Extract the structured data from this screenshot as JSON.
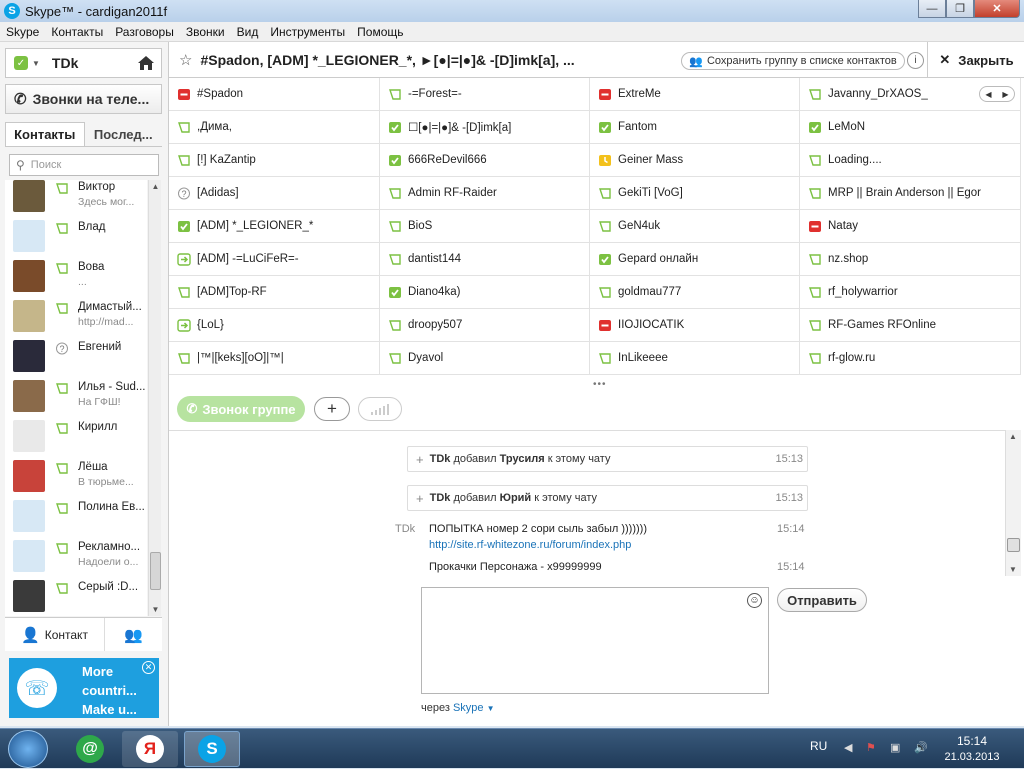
{
  "window": {
    "title": "Skype™ - cardigan2011f"
  },
  "menu": [
    "Skype",
    "Контакты",
    "Разговоры",
    "Звонки",
    "Вид",
    "Инструменты",
    "Помощь"
  ],
  "profile": {
    "name": "TDk",
    "status": "online"
  },
  "left": {
    "calls_label": "Звонки на теле...",
    "tabs": [
      "Контакты",
      "Послед..."
    ],
    "search_placeholder": "Поиск",
    "contacts": [
      {
        "name": "Виктор",
        "mood": "Здесь мог...",
        "status": "offline"
      },
      {
        "name": "Влад",
        "mood": "",
        "status": "offline"
      },
      {
        "name": "Вова",
        "mood": "...",
        "status": "offline"
      },
      {
        "name": "Димастый...",
        "mood": "http://mad...",
        "status": "offline"
      },
      {
        "name": "Евгений",
        "mood": "",
        "status": "unknown"
      },
      {
        "name": "Илья - Sud...",
        "mood": "На ГФШ!",
        "status": "offline"
      },
      {
        "name": "Кирилл",
        "mood": "",
        "status": "offline"
      },
      {
        "name": "Лёша",
        "mood": "В тюрьме...",
        "status": "offline"
      },
      {
        "name": "Полина Ев...",
        "mood": "",
        "status": "offline"
      },
      {
        "name": "Рекламно...",
        "mood": "Надоели о...",
        "status": "offline"
      },
      {
        "name": "Серый :D...",
        "mood": "",
        "status": "offline"
      }
    ],
    "add_contact_label": "Контакт",
    "promo": {
      "line1": "More",
      "line2": "countri...",
      "line3": "Make u..."
    }
  },
  "chat_header": {
    "name": "#Spadon, [ADM] *_LEGIONER_*, ►[●|=|●]& -[D]imk[a], ...",
    "save_group_label": "Сохранить группу в списке контактов",
    "close_label": "Закрыть"
  },
  "participants": [
    [
      "#Spadon",
      "-=Forest=-",
      "ExtreMe",
      "Javanny_DrXAOS_"
    ],
    [
      ",Дима,",
      "☐[●|=|●]& -[D]imk[a]",
      "Fantom",
      "LeMoN"
    ],
    [
      "[!] KaZantip",
      "666ReDevil666",
      "Geiner Mass",
      "Loading...."
    ],
    [
      "[Adidas]",
      "Admin RF-Raider",
      "GekiTi [VoG]",
      "MRP || Brain Anderson || Egor"
    ],
    [
      "[ADM] *_LEGIONER_*",
      "BioS",
      "GeN4uk",
      "Natay"
    ],
    [
      "[ADM] -=LuCiFeR=-",
      "dantist144",
      "Gepard онлайн",
      "nz.shop"
    ],
    [
      "[ADM]Top-RF",
      "Diano4ka)",
      "goldmau777",
      "rf_holywarrior"
    ],
    [
      "{LoL}",
      "droopy507",
      "IIOJIOCATIK",
      "RF-Games RFOnline"
    ],
    [
      "|™|[keks][oO]|™|",
      "Dyavol",
      "InLikeeee",
      "rf-glow.ru"
    ]
  ],
  "participant_status": [
    [
      "busy",
      "offline",
      "busy",
      "offline"
    ],
    [
      "offline",
      "online",
      "online",
      "online"
    ],
    [
      "offline",
      "online",
      "away",
      "offline"
    ],
    [
      "unknown",
      "offline",
      "offline",
      "offline"
    ],
    [
      "online",
      "offline",
      "offline",
      "busy"
    ],
    [
      "forward",
      "offline",
      "online",
      "offline"
    ],
    [
      "offline",
      "online",
      "offline",
      "offline"
    ],
    [
      "forward",
      "offline",
      "busy",
      "offline"
    ],
    [
      "offline",
      "offline",
      "offline",
      "offline"
    ]
  ],
  "callbar": {
    "call_group_label": "Звонок группе"
  },
  "events": [
    {
      "actor": "TDk",
      "verb": "добавил",
      "target": "Трусиля",
      "suffix": "к этому чату",
      "time": "15:13"
    },
    {
      "actor": "TDk",
      "verb": "добавил",
      "target": "Юрий",
      "suffix": "к этому чату",
      "time": "15:13"
    }
  ],
  "message": {
    "author": "TDk",
    "text": "ПОПЫТКА номер 2 сори сыль забыл )))))))",
    "link": "http://site.rf-whitezone.ru/forum/index.php",
    "time": "15:14",
    "text2": "Прокачки Персонажа - х99999999",
    "time2": "15:14"
  },
  "composer": {
    "send_label": "Отправить",
    "via_prefix": "через",
    "via_service": "Skype"
  },
  "taskbar": {
    "lang": "RU",
    "time": "15:14",
    "date": "21.03.2013"
  },
  "colors": {
    "online": "#7cc142",
    "busy": "#e0302e",
    "away": "#f3c11b",
    "skype_blue": "#1e9fdf"
  }
}
